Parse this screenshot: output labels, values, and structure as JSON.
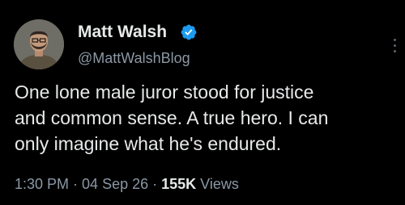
{
  "author": {
    "display_name": "Matt Walsh",
    "handle": "@MattWalshBlog",
    "verified": true
  },
  "tweet": {
    "lines": [
      "One lone male juror stood for justice",
      "and common sense. A true hero. I can",
      "only imagine what he's endured."
    ]
  },
  "meta": {
    "time": "1:30 PM",
    "date": "04 Sep 26",
    "views_count": "155K",
    "views_label": "Views",
    "separator": "·"
  },
  "colors": {
    "background": "#000000",
    "text": "#e7e9ea",
    "secondary_text": "#8b98a5",
    "verified_badge": "#1d9bf0"
  },
  "icons": {
    "verified": "verified-badge-icon",
    "more": "more-options-icon"
  }
}
